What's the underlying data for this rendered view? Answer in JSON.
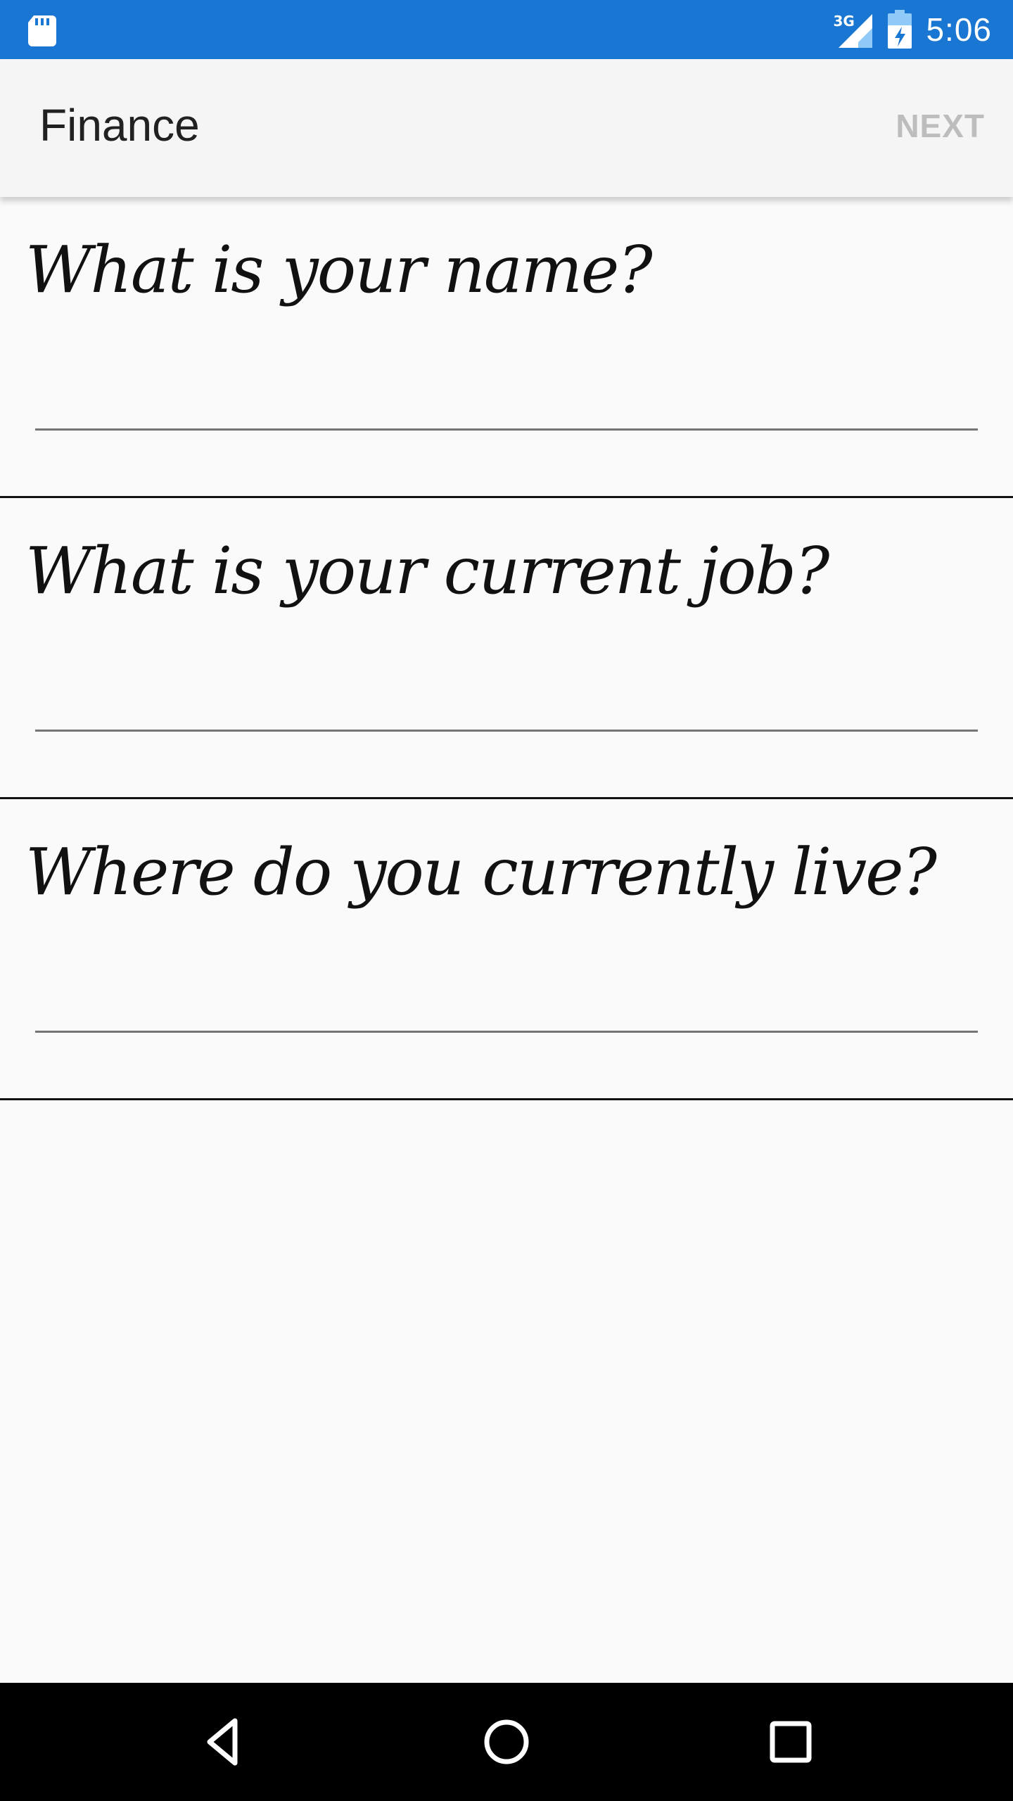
{
  "status_bar": {
    "network_type": "3G",
    "time": "5:06",
    "icons": [
      "sd-card-icon",
      "signal-icon",
      "battery-icon"
    ],
    "background_color": "#1976d2"
  },
  "toolbar": {
    "title": "Finance",
    "next_label": "NEXT",
    "next_color": "#bdbdbd"
  },
  "questions": [
    {
      "label": "What is your name?",
      "value": ""
    },
    {
      "label": "What is your current job?",
      "value": ""
    },
    {
      "label": "Where do you currently live?",
      "value": ""
    }
  ],
  "nav_bar": {
    "icons": [
      "back-icon",
      "home-icon",
      "recents-icon"
    ]
  }
}
